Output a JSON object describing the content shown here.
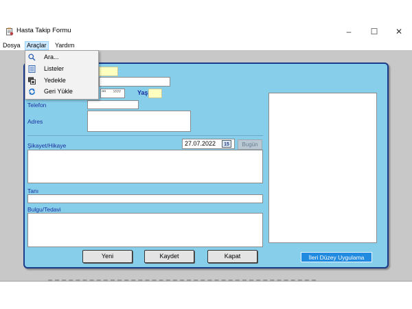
{
  "window": {
    "title": "Hasta Takip Formu",
    "minimize_glyph": "–",
    "maximize_glyph": "☐",
    "close_glyph": "✕"
  },
  "menubar": {
    "items": [
      {
        "label": "Dosya"
      },
      {
        "label": "Araçlar"
      },
      {
        "label": "Yardım"
      }
    ]
  },
  "dropdown": {
    "items": [
      {
        "label": "Ara...",
        "icon": "search-icon"
      },
      {
        "label": "Listeler",
        "icon": "list-icon"
      },
      {
        "label": "Yedekle",
        "icon": "backup-icon"
      },
      {
        "label": "Geri Yükle",
        "icon": "restore-icon"
      }
    ]
  },
  "form": {
    "date_placeholder_mm": "aa",
    "date_placeholder_yyyy": "yyyy",
    "age_label": "Yaş",
    "phone_label": "Telefon",
    "address_label": "Adres",
    "complaint_label": "Şikayet/Hikaye",
    "visit_date": "27.07.2022",
    "calendar_day": "15",
    "today_label": "Bugün",
    "diagnosis_label": "Tanı",
    "findings_label": "Bulgu/Tedavi",
    "buttons": {
      "new": "Yeni",
      "save": "Kaydet",
      "close": "Kapat"
    },
    "advanced_label": "İleri Düzey Uygulama"
  },
  "colors": {
    "panel": "#87ceeb",
    "panel_border": "#1a3a8a",
    "label": "#1a2f9c",
    "advanced_button": "#1f8ae0",
    "highlight_field": "#ffffc0"
  }
}
